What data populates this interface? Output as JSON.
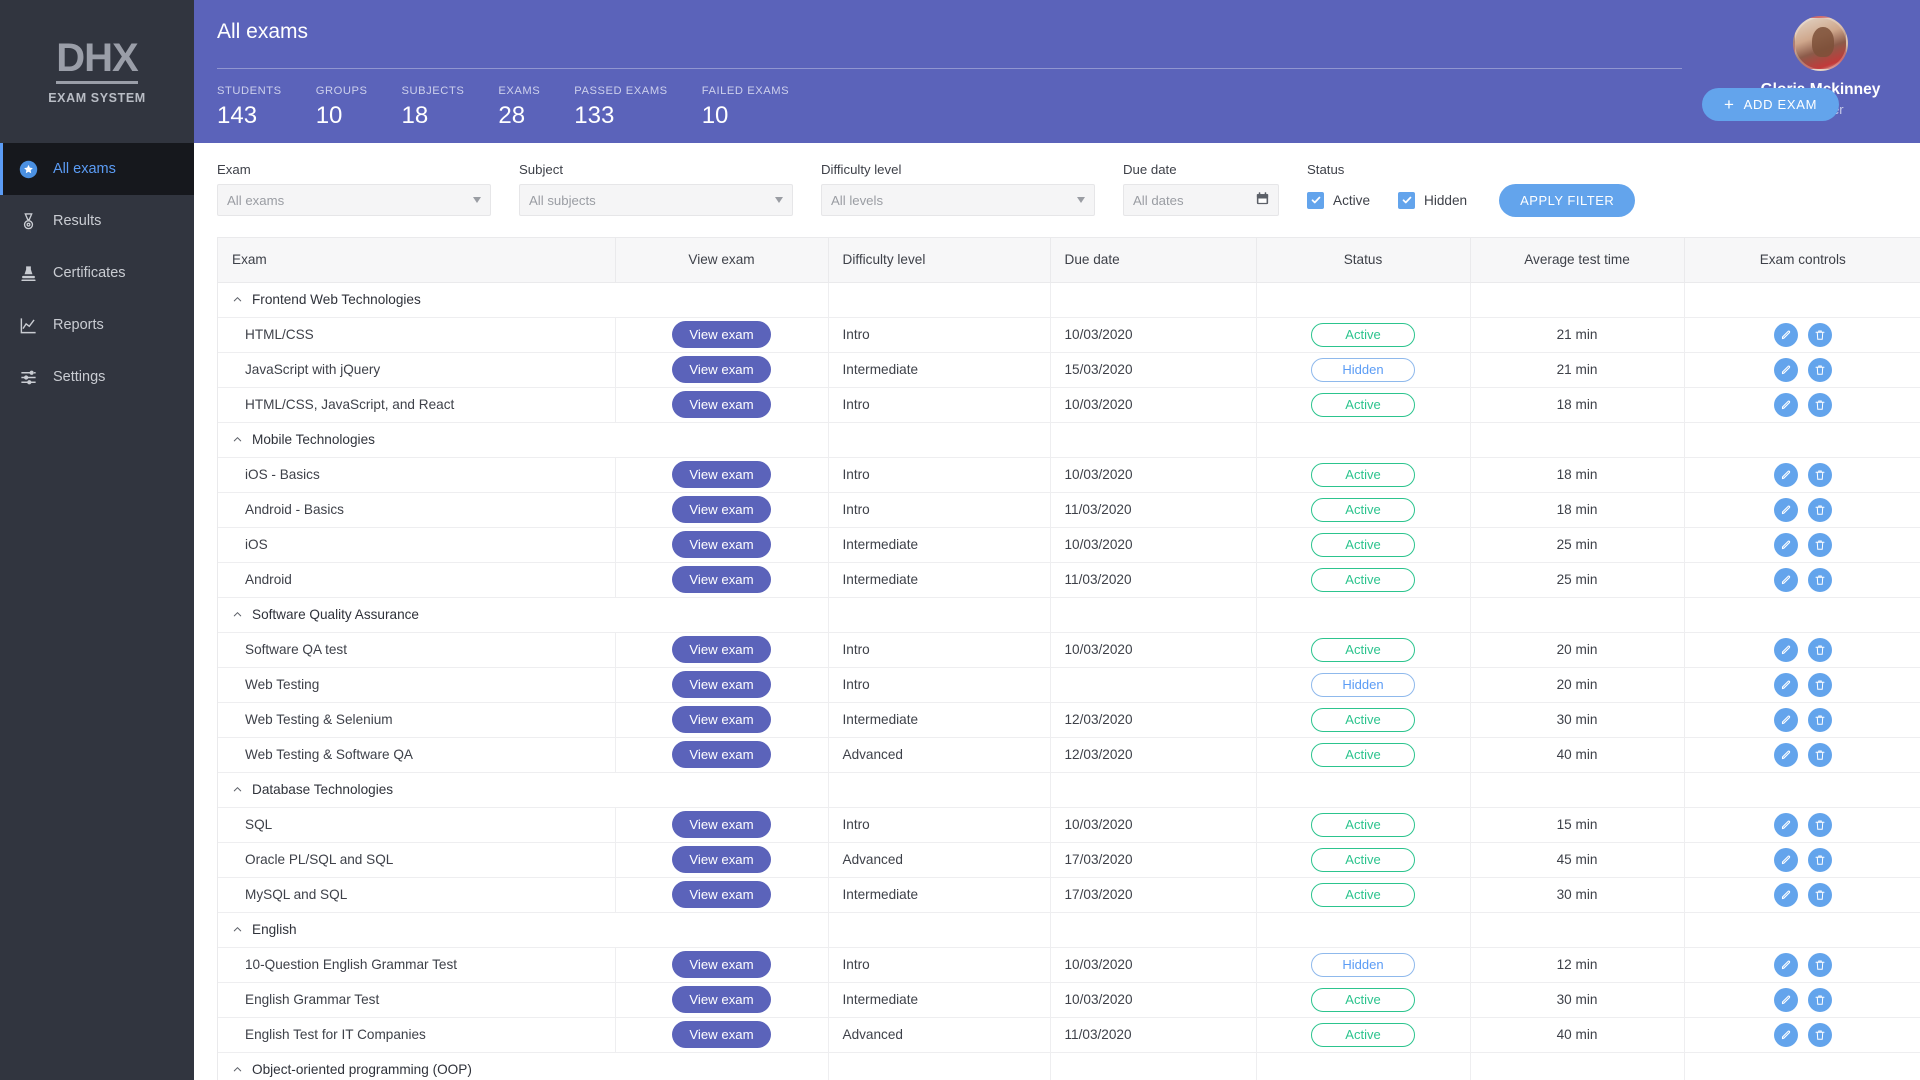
{
  "brand": {
    "logo_mark": "DHX",
    "logo_sub": "EXAM SYSTEM"
  },
  "sidebar": {
    "items": [
      {
        "label": "All exams",
        "icon": "star-badge-icon",
        "active": true
      },
      {
        "label": "Results",
        "icon": "medal-icon",
        "active": false
      },
      {
        "label": "Certificates",
        "icon": "stamp-icon",
        "active": false
      },
      {
        "label": "Reports",
        "icon": "chart-line-icon",
        "active": false
      },
      {
        "label": "Settings",
        "icon": "sliders-icon",
        "active": false
      }
    ]
  },
  "header": {
    "title": "All exams",
    "stats": [
      {
        "label": "STUDENTS",
        "value": "143"
      },
      {
        "label": "GROUPS",
        "value": "10"
      },
      {
        "label": "SUBJECTS",
        "value": "18"
      },
      {
        "label": "EXAMS",
        "value": "28"
      },
      {
        "label": "PASSED EXAMS",
        "value": "133"
      },
      {
        "label": "FAILED EXAMS",
        "value": "10"
      }
    ],
    "add_exam_label": "ADD EXAM",
    "user": {
      "name": "Gloria Mckinney",
      "role": "Teacher"
    }
  },
  "filters": {
    "exam": {
      "label": "Exam",
      "value": "All exams"
    },
    "subject": {
      "label": "Subject",
      "value": "All subjects"
    },
    "difficulty": {
      "label": "Difficulty level",
      "value": "All levels"
    },
    "due_date": {
      "label": "Due date",
      "value": "All dates"
    },
    "status": {
      "label": "Status",
      "active": {
        "label": "Active",
        "checked": true
      },
      "hidden": {
        "label": "Hidden",
        "checked": true
      }
    },
    "apply_label": "APPLY FILTER"
  },
  "table": {
    "columns": [
      "Exam",
      "View exam",
      "Difficulty level",
      "Due date",
      "Status",
      "Average test time",
      "Exam controls"
    ],
    "view_exam_label": "View exam",
    "groups": [
      {
        "name": "Frontend Web Technologies",
        "rows": [
          {
            "exam": "HTML/CSS",
            "difficulty": "Intro",
            "due": "10/03/2020",
            "status": "Active",
            "time": "21 min"
          },
          {
            "exam": "JavaScript with jQuery",
            "difficulty": "Intermediate",
            "due": "15/03/2020",
            "status": "Hidden",
            "time": "21 min"
          },
          {
            "exam": "HTML/CSS, JavaScript, and React",
            "difficulty": "Intro",
            "due": "10/03/2020",
            "status": "Active",
            "time": "18 min"
          }
        ]
      },
      {
        "name": "Mobile Technologies",
        "rows": [
          {
            "exam": "iOS - Basics",
            "difficulty": "Intro",
            "due": "10/03/2020",
            "status": "Active",
            "time": "18 min"
          },
          {
            "exam": "Android - Basics",
            "difficulty": "Intro",
            "due": "11/03/2020",
            "status": "Active",
            "time": "18 min"
          },
          {
            "exam": "iOS",
            "difficulty": "Intermediate",
            "due": "10/03/2020",
            "status": "Active",
            "time": "25 min"
          },
          {
            "exam": "Android",
            "difficulty": "Intermediate",
            "due": "11/03/2020",
            "status": "Active",
            "time": "25 min"
          }
        ]
      },
      {
        "name": "Software Quality Assurance",
        "rows": [
          {
            "exam": "Software QA test",
            "difficulty": "Intro",
            "due": "10/03/2020",
            "status": "Active",
            "time": "20 min"
          },
          {
            "exam": "Web Testing",
            "difficulty": "Intro",
            "due": "",
            "status": "Hidden",
            "time": "20 min"
          },
          {
            "exam": "Web Testing & Selenium",
            "difficulty": "Intermediate",
            "due": "12/03/2020",
            "status": "Active",
            "time": "30 min"
          },
          {
            "exam": "Web Testing & Software QA",
            "difficulty": "Advanced",
            "due": "12/03/2020",
            "status": "Active",
            "time": "40 min"
          }
        ]
      },
      {
        "name": "Database Technologies",
        "rows": [
          {
            "exam": "SQL",
            "difficulty": "Intro",
            "due": "10/03/2020",
            "status": "Active",
            "time": "15 min"
          },
          {
            "exam": "Oracle PL/SQL and SQL",
            "difficulty": "Advanced",
            "due": "17/03/2020",
            "status": "Active",
            "time": "45 min"
          },
          {
            "exam": "MySQL and SQL",
            "difficulty": "Intermediate",
            "due": "17/03/2020",
            "status": "Active",
            "time": "30 min"
          }
        ]
      },
      {
        "name": "English",
        "rows": [
          {
            "exam": "10-Question English Grammar Test",
            "difficulty": "Intro",
            "due": "10/03/2020",
            "status": "Hidden",
            "time": "12 min"
          },
          {
            "exam": "English Grammar Test",
            "difficulty": "Intermediate",
            "due": "10/03/2020",
            "status": "Active",
            "time": "30 min"
          },
          {
            "exam": "English Test for IT Companies",
            "difficulty": "Advanced",
            "due": "11/03/2020",
            "status": "Active",
            "time": "40 min"
          }
        ]
      },
      {
        "name": "Object-oriented programming (OOP)",
        "rows": []
      }
    ]
  },
  "colors": {
    "sidebar_bg": "#31353f",
    "sidebar_active_bg": "#16181d",
    "accent_blue": "#63a4ec",
    "brand_purple": "#5b63ba",
    "status_active": "#2cc48e",
    "status_hidden": "#5b9cf5"
  }
}
